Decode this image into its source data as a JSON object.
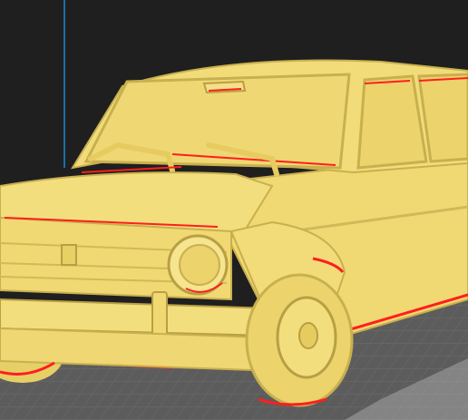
{
  "viewport": {
    "background": "#1f1f1f",
    "build_plate": "#5c5c5c",
    "grid_line": "#7a7a7a",
    "axis_line": "#1aa3ff"
  },
  "model": {
    "name": "car-model",
    "body_color": "#f2dc7a",
    "shade_color": "#c9b04f",
    "highlight_color": "#fff1a8",
    "overhang_color": "#ff1e1e"
  }
}
